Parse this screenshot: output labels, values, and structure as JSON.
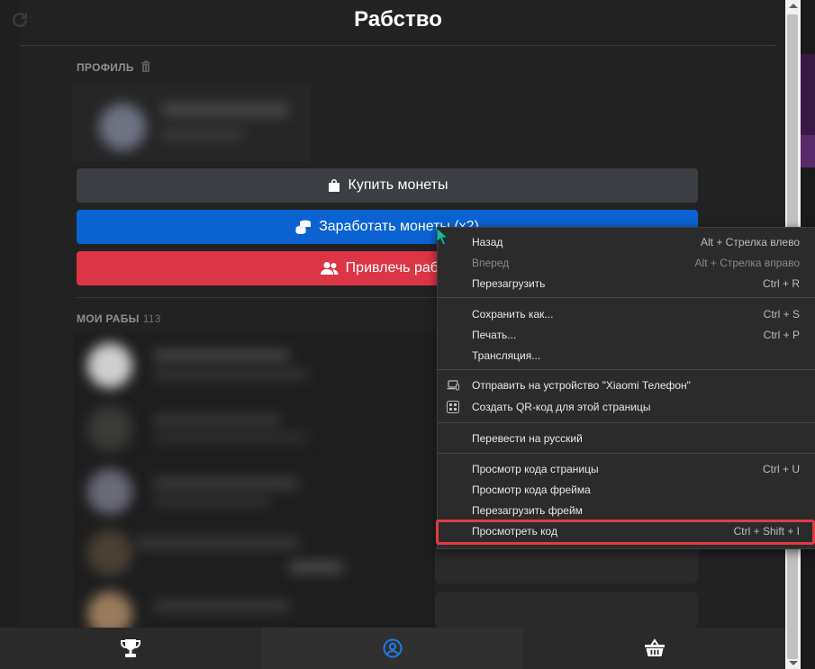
{
  "app": {
    "title": "Рабство",
    "profile_label": "ПРОФИЛЬ",
    "buttons": {
      "buy": "Купить монеты",
      "earn": "Заработать монеты (x2)",
      "invite": "Привлечь рабов"
    },
    "slaves": {
      "label": "МОИ РАБЫ",
      "count": "113"
    },
    "bottom_nav": [
      "trophy-icon",
      "profile-icon",
      "shop-basket-icon"
    ],
    "colors": {
      "earn": "#0a63d1",
      "invite": "#dc3545",
      "buy": "#3b3f44",
      "active_tab_icon": "#1e7be6"
    }
  },
  "context_menu": {
    "items": [
      {
        "label": "Назад",
        "shortcut": "Alt + Стрелка влево"
      },
      {
        "label": "Вперед",
        "shortcut": "Alt + Стрелка вправо",
        "disabled": true
      },
      {
        "label": "Перезагрузить",
        "shortcut": "Ctrl + R"
      },
      {
        "label": "Сохранить как...",
        "shortcut": "Ctrl + S"
      },
      {
        "label": "Печать...",
        "shortcut": "Ctrl + P"
      },
      {
        "label": "Трансляция..."
      },
      {
        "label": "Отправить на устройство \"Xiaomi Телефон\"",
        "icon": "device-send-icon"
      },
      {
        "label": "Создать QR-код для этой страницы",
        "icon": "qr-code-icon"
      },
      {
        "label": "Перевести на русский"
      },
      {
        "label": "Просмотр кода страницы",
        "shortcut": "Ctrl + U"
      },
      {
        "label": "Просмотр кода фрейма"
      },
      {
        "label": "Перезагрузить фрейм"
      },
      {
        "label": "Просмотреть код",
        "shortcut": "Ctrl + Shift + I",
        "highlighted": true
      }
    ],
    "highlight_color": "#e03b44"
  }
}
